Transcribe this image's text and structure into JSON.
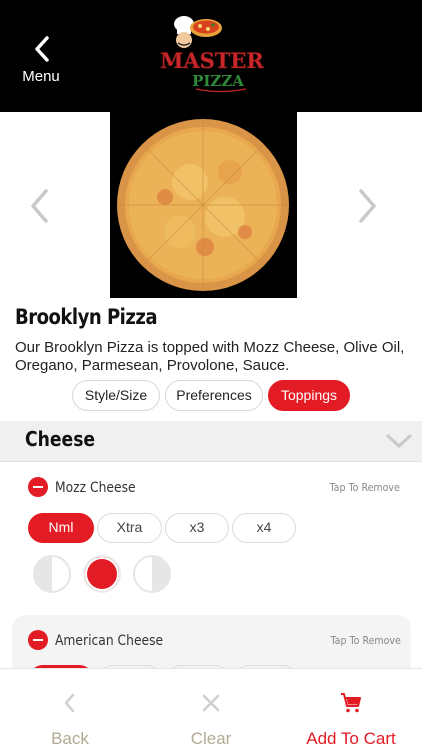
{
  "header": {
    "back_label": "Menu",
    "logo_text_top": "MASTER",
    "logo_text_bottom": "PIZZA"
  },
  "product": {
    "title": "Brooklyn Pizza",
    "description": "Our Brooklyn Pizza is topped with Mozz Cheese, Olive Oil, Oregano, Parmesean, Provolone, Sauce."
  },
  "tabs": [
    {
      "label": "Style/Size",
      "active": false
    },
    {
      "label": "Preferences",
      "active": false
    },
    {
      "label": "Toppings",
      "active": true
    }
  ],
  "section": {
    "title": "Cheese"
  },
  "toppings": [
    {
      "name": "Mozz Cheese",
      "remove_label": "Tap To Remove",
      "amounts": [
        "Nml",
        "Xtra",
        "x3",
        "x4"
      ],
      "selected_amount": "Nml",
      "portion_selected": "whole"
    },
    {
      "name": "American Cheese",
      "remove_label": "Tap To Remove"
    }
  ],
  "bottom_bar": {
    "back_label": "Back",
    "clear_label": "Clear",
    "add_to_cart_label": "Add To Cart"
  },
  "colors": {
    "accent": "#e21b24",
    "header_bg": "#000000",
    "muted_label": "#b3aa93"
  }
}
